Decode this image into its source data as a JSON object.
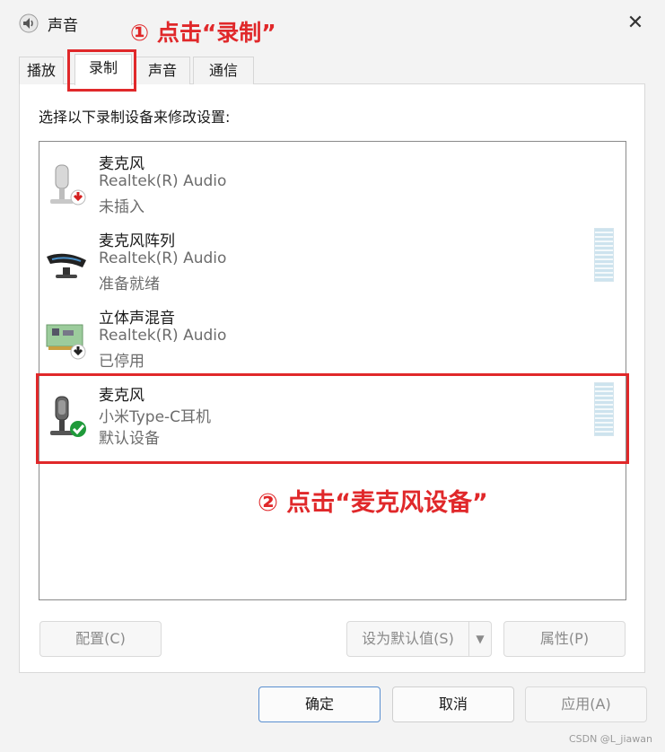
{
  "window": {
    "title": "声音",
    "close_glyph": "✕"
  },
  "annotations": {
    "step1": "① 点击“录制”",
    "step2": "② 点击“麦克风设备”",
    "highlight_color": "#e0282a"
  },
  "tabs": [
    {
      "label": "播放",
      "active": false
    },
    {
      "label": "录制",
      "active": true
    },
    {
      "label": "声音",
      "active": false
    },
    {
      "label": "通信",
      "active": false
    }
  ],
  "instruction": "选择以下录制设备来修改设置:",
  "devices": [
    {
      "name": "麦克风",
      "driver": "Realtek(R) Audio",
      "status": "未插入",
      "icon": "microphone-unplugged-icon",
      "level_meter": false
    },
    {
      "name": "麦克风阵列",
      "driver": "Realtek(R) Audio",
      "status": "准备就绪",
      "icon": "microphone-array-icon",
      "level_meter": true
    },
    {
      "name": "立体声混音",
      "driver": "Realtek(R) Audio",
      "status": "已停用",
      "icon": "sound-card-disabled-icon",
      "level_meter": false
    },
    {
      "name": "麦克风",
      "driver": "小米Type-C耳机",
      "status": "默认设备",
      "icon": "microphone-default-icon",
      "level_meter": true,
      "selected": true
    }
  ],
  "buttons": {
    "configure": "配置(C)",
    "set_default": "设为默认值(S)",
    "set_default_arrow": "▼",
    "properties": "属性(P)",
    "ok": "确定",
    "cancel": "取消",
    "apply": "应用(A)"
  },
  "watermark": "CSDN @L_jiawan"
}
